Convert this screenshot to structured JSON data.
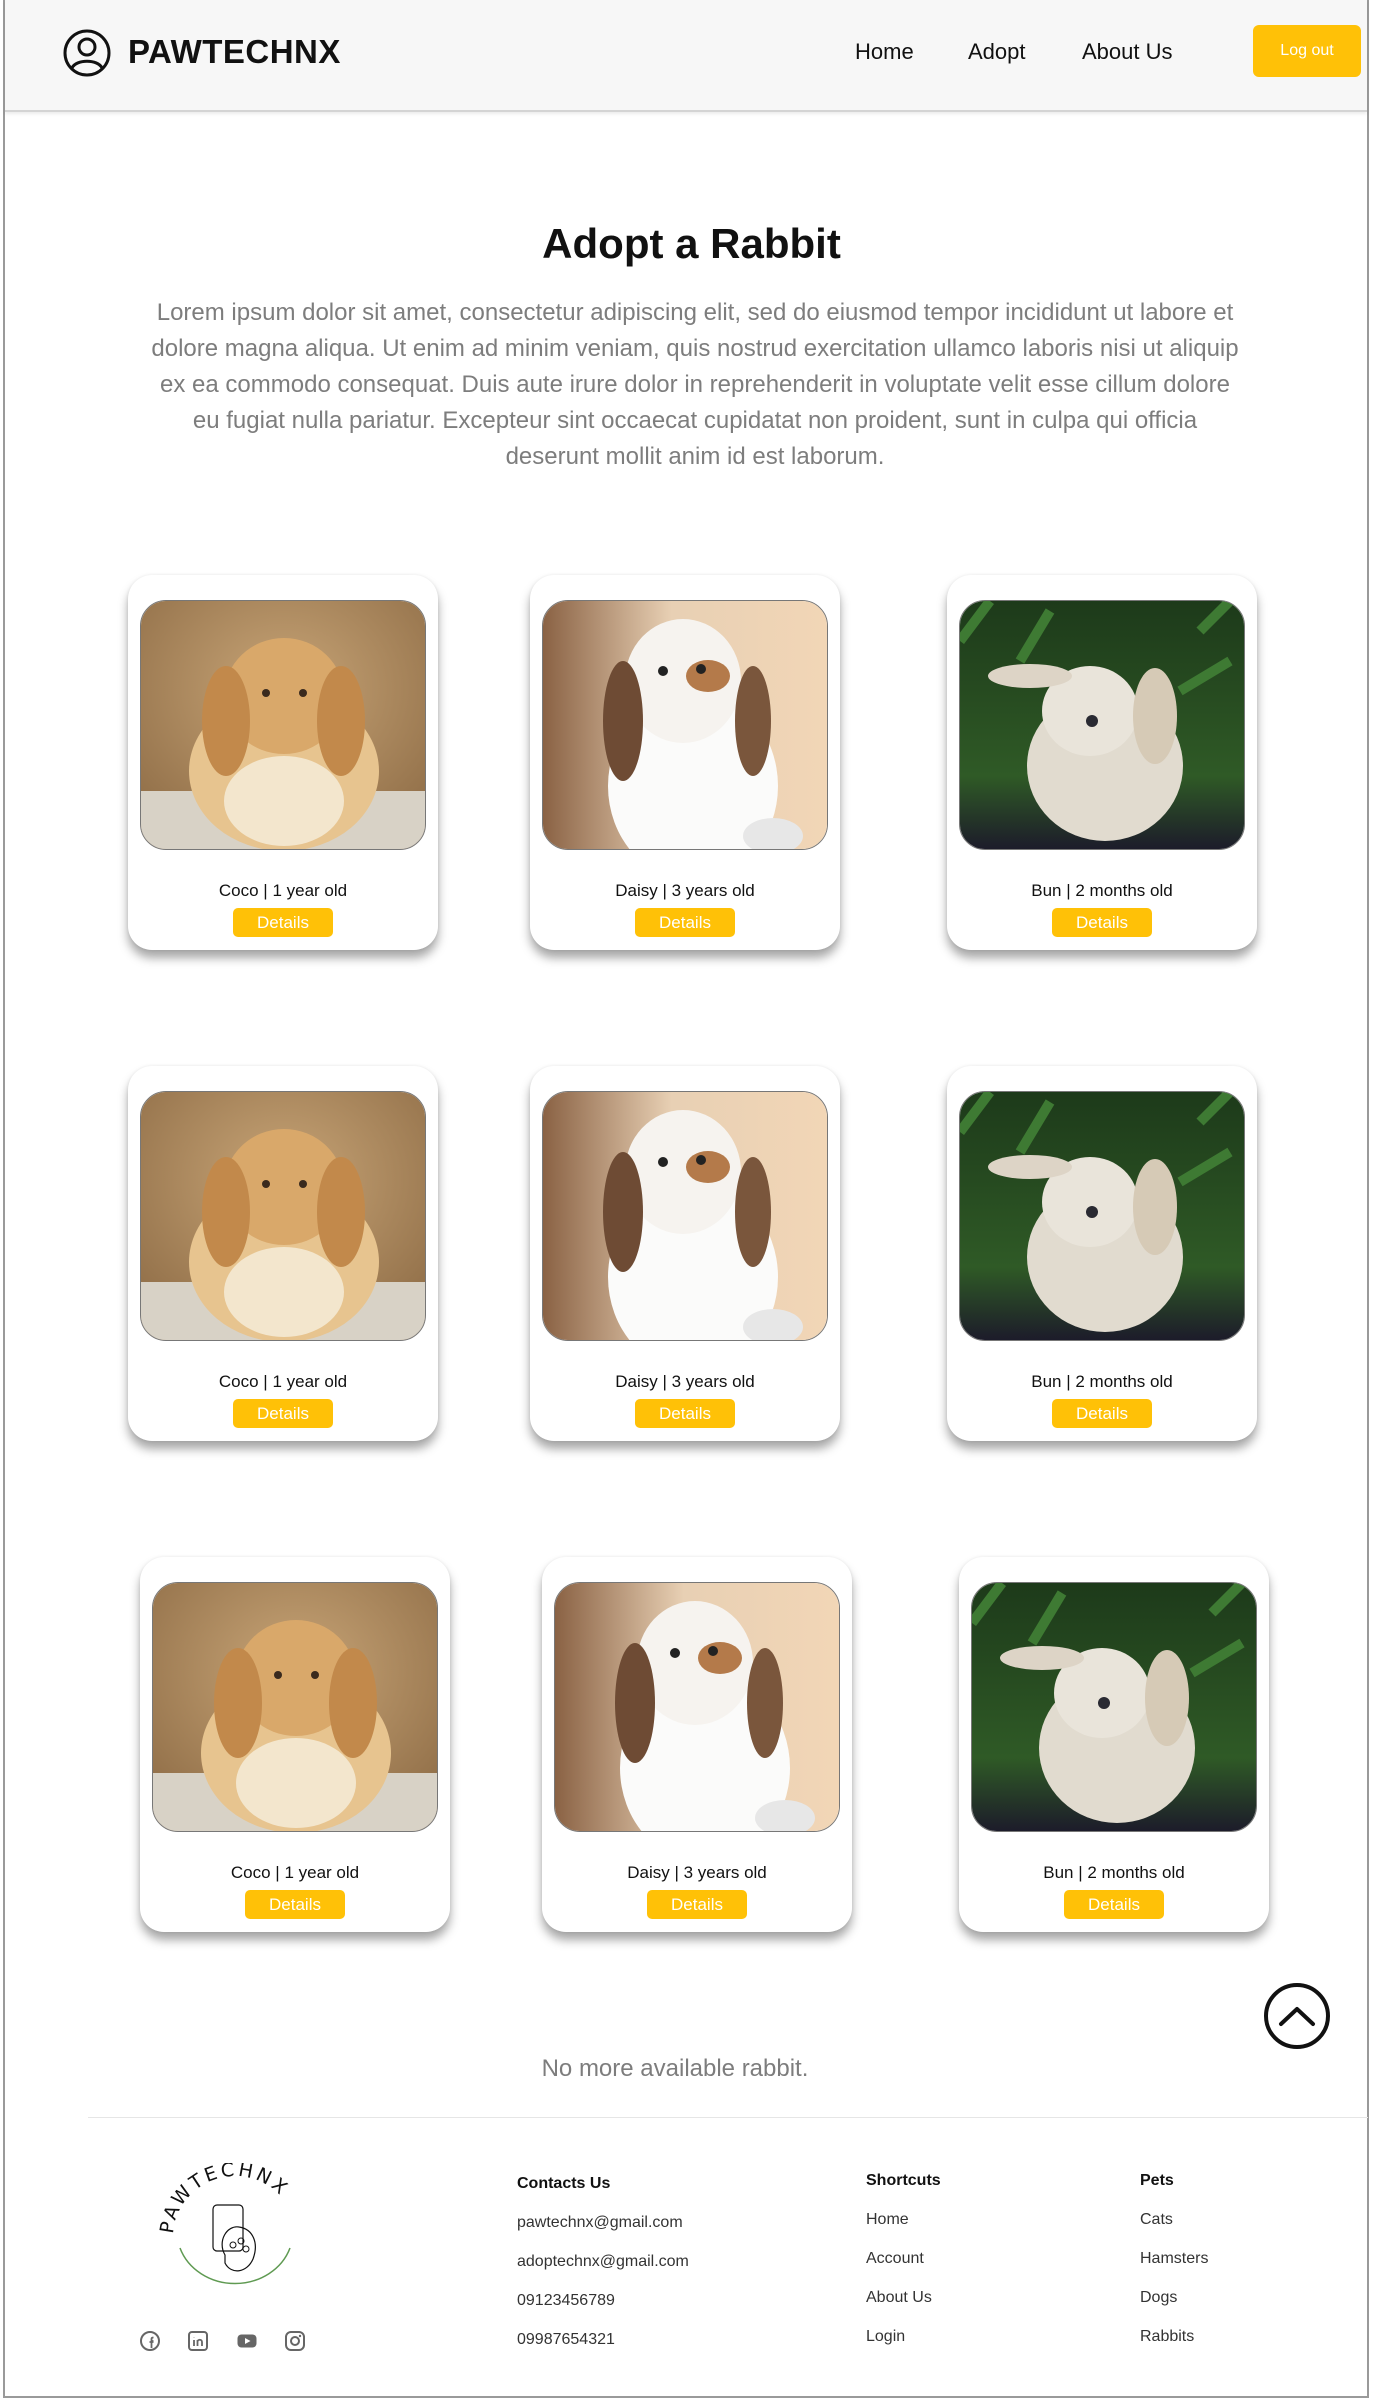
{
  "header": {
    "brand": "PAWTECHNX",
    "nav": [
      "Home",
      "Adopt",
      "About Us"
    ],
    "logout_label": "Log out",
    "accent_color": "#FFC107"
  },
  "main": {
    "title": "Adopt a Rabbit",
    "intro": "Lorem ipsum dolor sit amet, consectetur adipiscing elit, sed do eiusmod tempor incididunt ut labore et dolore magna aliqua. Ut enim ad minim veniam, quis nostrud exercitation ullamco laboris nisi ut aliquip ex ea commodo consequat. Duis aute irure dolor in reprehenderit in voluptate velit esse cillum dolore eu fugiat nulla pariatur. Excepteur sint occaecat cupidatat non proident, sunt in culpa qui officia deserunt mollit anim id est laborum.",
    "details_label": "Details",
    "rows": [
      [
        {
          "caption": "Coco | 1 year old",
          "photo": "orange-lop-rabbit"
        },
        {
          "caption": "Daisy | 3 years old",
          "photo": "white-brown-lop-rabbit"
        },
        {
          "caption": "Bun | 2 months old",
          "photo": "cream-rabbit-in-leaves"
        }
      ],
      [
        {
          "caption": "Coco | 1 year old",
          "photo": "orange-lop-rabbit"
        },
        {
          "caption": "Daisy | 3 years old",
          "photo": "white-brown-lop-rabbit"
        },
        {
          "caption": "Bun | 2 months old",
          "photo": "cream-rabbit-in-leaves"
        }
      ],
      [
        {
          "caption": "Coco | 1 year old",
          "photo": "orange-lop-rabbit"
        },
        {
          "caption": "Daisy | 3 years old",
          "photo": "white-brown-lop-rabbit"
        },
        {
          "caption": "Bun | 2 months old",
          "photo": "cream-rabbit-in-leaves"
        }
      ]
    ],
    "no_more": "No more available rabbit."
  },
  "footer": {
    "logo_text": "PAWTECHNX",
    "social_icons": [
      "facebook-icon",
      "linkedin-icon",
      "youtube-icon",
      "instagram-icon"
    ],
    "contacts": {
      "heading": "Contacts Us",
      "items": [
        "pawtechnx@gmail.com",
        "adoptechnx@gmail.com",
        "09123456789",
        "09987654321"
      ]
    },
    "shortcuts": {
      "heading": "Shortcuts",
      "items": [
        "Home",
        "Account",
        "About Us",
        "Login"
      ]
    },
    "pets": {
      "heading": "Pets",
      "items": [
        "Cats",
        "Hamsters",
        "Dogs",
        "Rabbits"
      ]
    }
  }
}
